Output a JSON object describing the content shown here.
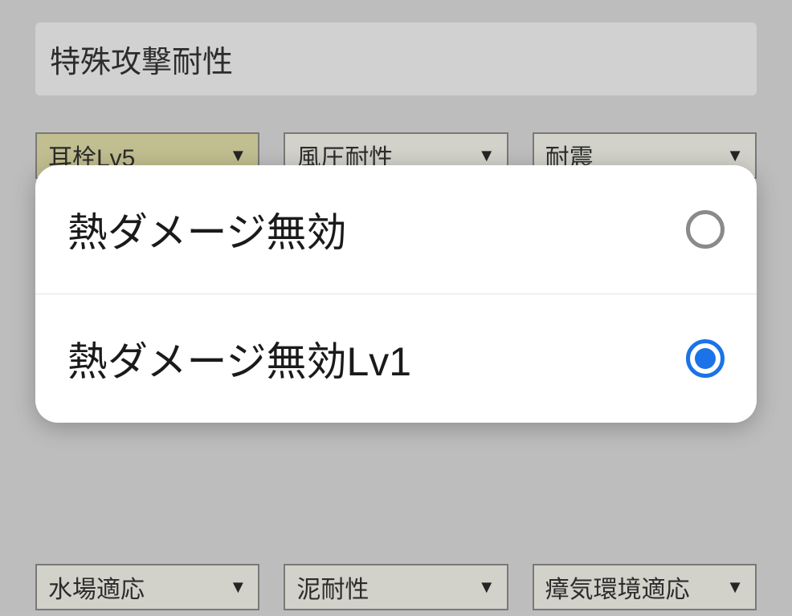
{
  "section": {
    "title": "特殊攻撃耐性"
  },
  "dropdowns": {
    "row1": [
      {
        "label": "耳栓Lv5",
        "highlight": true
      },
      {
        "label": "風圧耐性",
        "highlight": false
      },
      {
        "label": "耐震",
        "highlight": false
      }
    ],
    "row2": [
      {
        "label": "水場適応",
        "highlight": false
      },
      {
        "label": "泥耐性",
        "highlight": false
      },
      {
        "label": "瘴気環境適応",
        "highlight": false
      }
    ]
  },
  "modal": {
    "options": [
      {
        "label": "熱ダメージ無効",
        "selected": false
      },
      {
        "label": "熱ダメージ無効Lv1",
        "selected": true
      }
    ]
  }
}
